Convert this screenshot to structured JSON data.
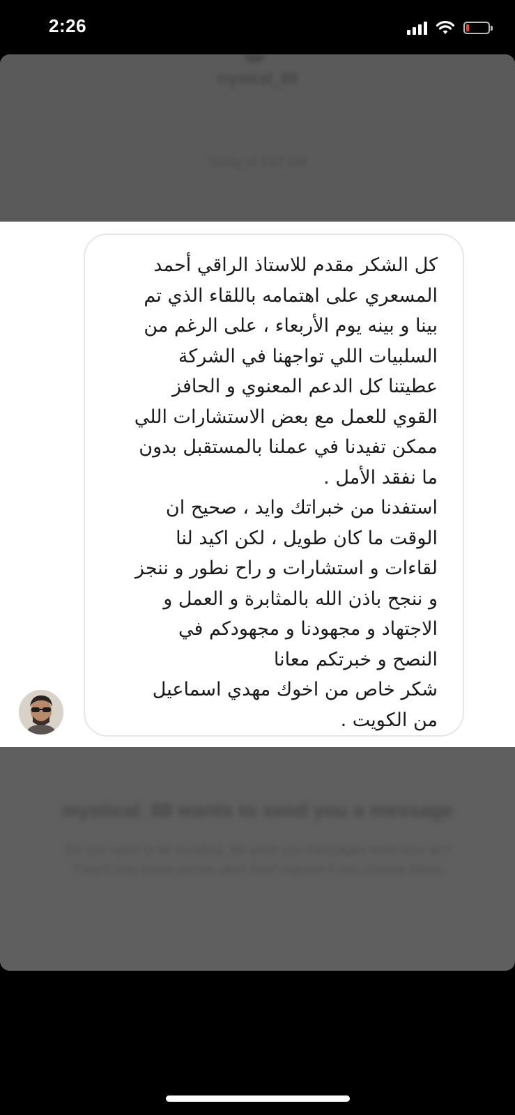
{
  "status_bar": {
    "time": "2:26",
    "battery_color": "#ff3b30",
    "icons": [
      "cellular-signal-icon",
      "wifi-icon",
      "battery-low-icon"
    ]
  },
  "conversation": {
    "username": "mystical_88",
    "timestamp": "Today at 3:57 AM"
  },
  "message": {
    "lines": [
      "كل الشكر مقدم للاستاذ الراقي أحمد",
      "المسعري على اهتمامه باللقاء الذي تم",
      "بينا و بينه يوم الأربعاء ، على الرغم من",
      "السلبيات اللي تواجهنا في الشركة",
      "عطيتنا كل الدعم المعنوي و الحافز",
      "القوي للعمل مع بعض الاستشارات اللي",
      "ممكن تفيدنا في عملنا بالمستقبل بدون",
      "ما نفقد الأمل  .",
      "استفدنا من خبراتك وايد ، صحيح ان",
      "الوقت ما كان طويل ، لكن اكيد لنا",
      "لقاءات و استشارات و راح نطور و ننجز",
      "و ننجح باذن الله بالمثابرة و العمل و",
      "الاجتهاد و مجهودنا و مجهودكم في",
      "النصح و خبرتكم معانا",
      "شكر خاص من اخوك مهدي اسماعيل",
      "من الكويت ."
    ]
  },
  "request": {
    "title": "mystical_88 wants to send you a message",
    "body": "Do you want to let mystical_88 send you messages from now on? They'll only know you've seen their request if you choose Allow."
  }
}
